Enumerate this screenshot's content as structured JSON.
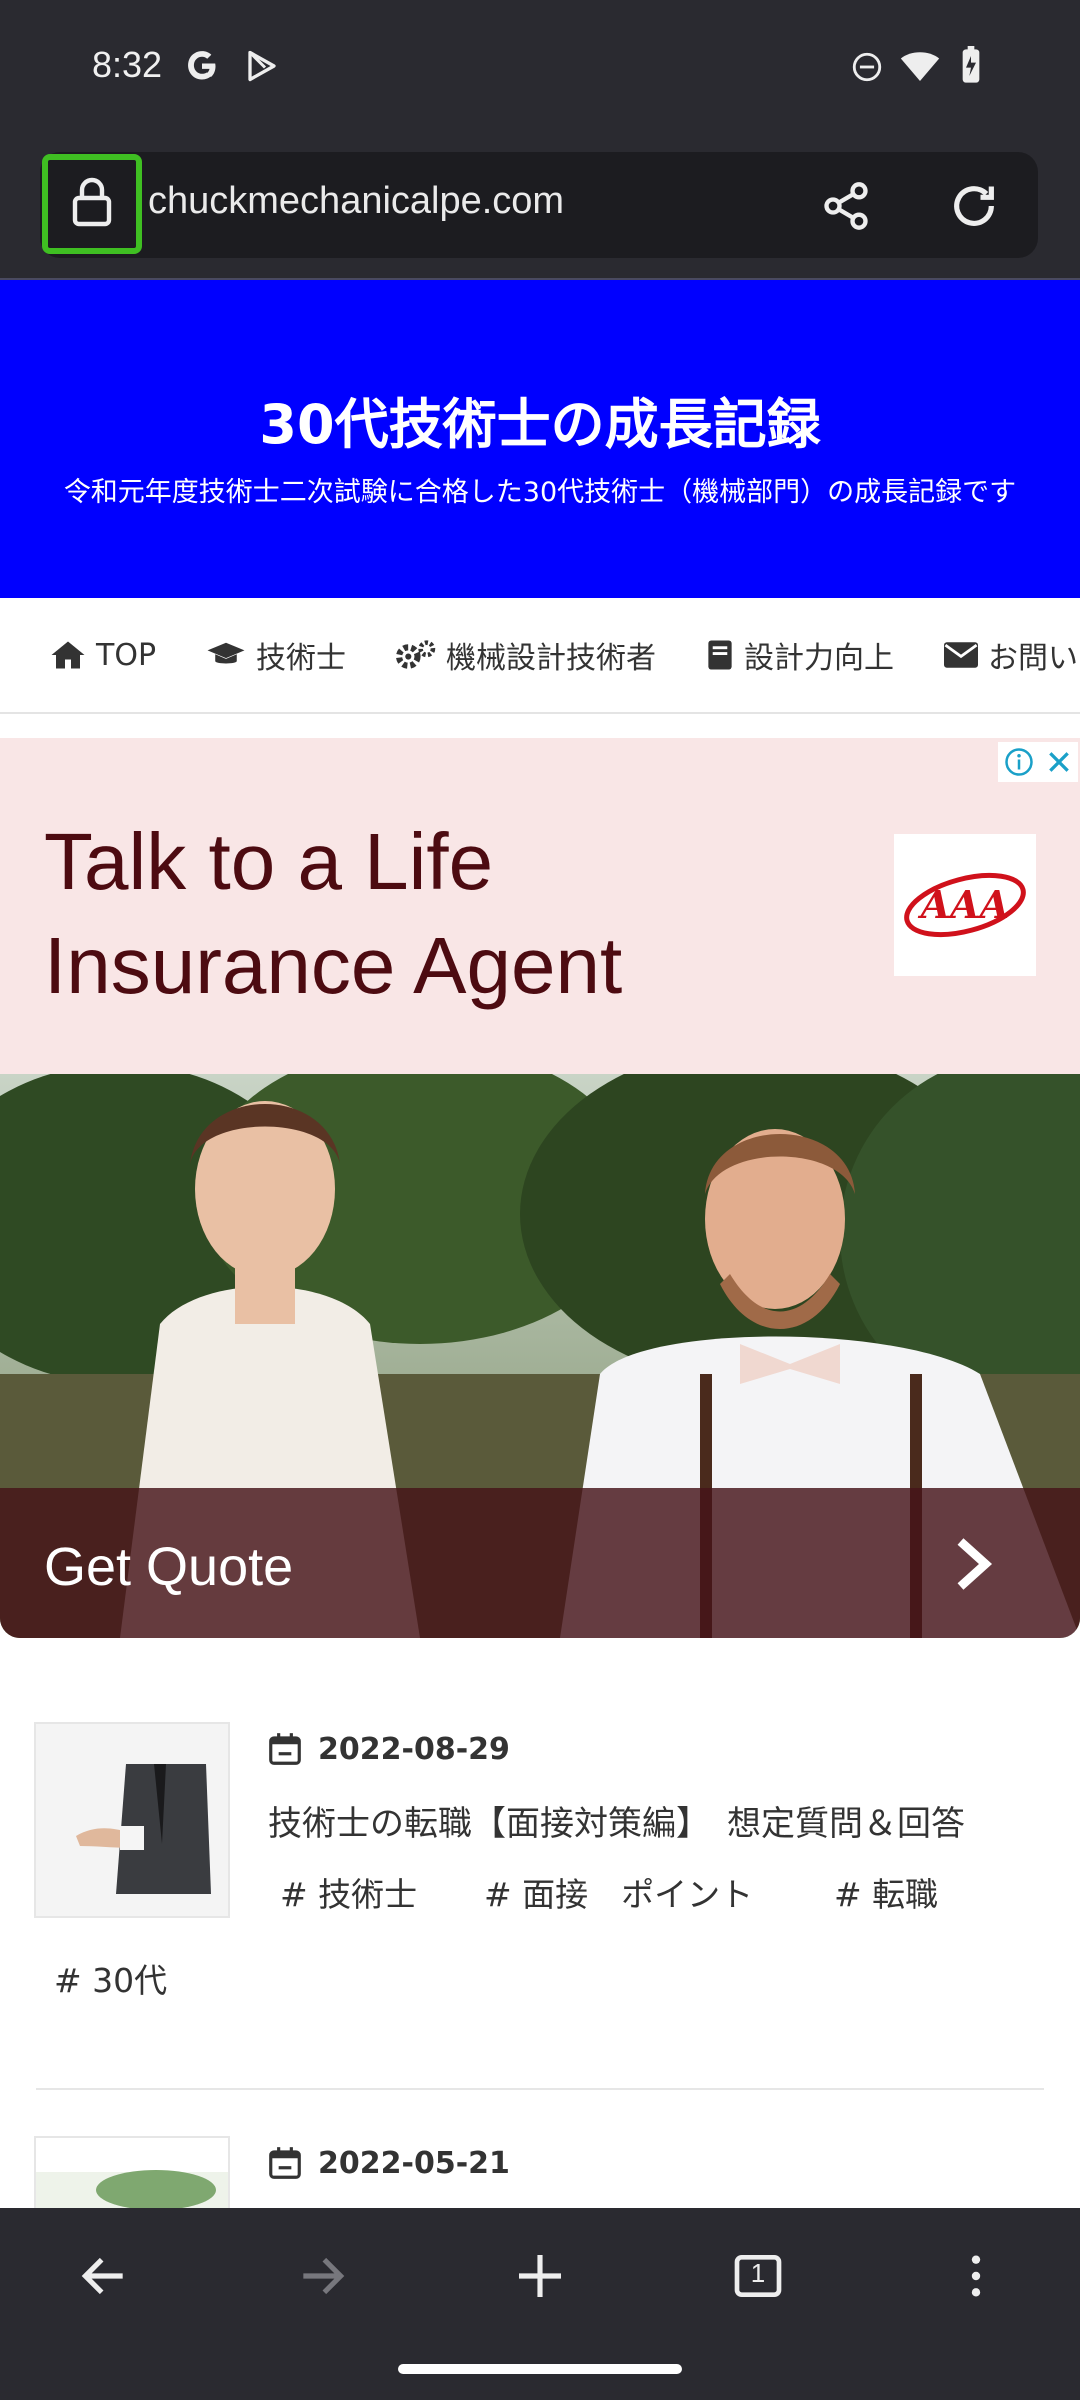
{
  "status_bar": {
    "time": "8:32"
  },
  "browser": {
    "url": "chuckmechanicalpe.com",
    "tab_count": "1"
  },
  "site": {
    "title": "30代技術士の成長記録",
    "subtitle": "令和元年度技術士二次試験に合格した30代技術士（機械部門）の成長記録です"
  },
  "nav": [
    {
      "label": "TOP",
      "icon": "home-icon"
    },
    {
      "label": "技術士",
      "icon": "graduation-cap-icon"
    },
    {
      "label": "機械設計技術者",
      "icon": "gears-icon"
    },
    {
      "label": "設計力向上",
      "icon": "book-icon"
    },
    {
      "label": "お問い",
      "icon": "envelope-icon"
    }
  ],
  "ad": {
    "headline_line1": "Talk to a Life",
    "headline_line2": "Insurance Agent",
    "logo_text": "AAA",
    "cta": "Get Quote"
  },
  "posts": [
    {
      "date": "2022-08-29",
      "title": "技術士の転職【面接対策編】　想定質問＆回答",
      "tags": [
        "# 技術士",
        "# 面接　ポイント",
        "# 転職",
        "# 30代"
      ]
    },
    {
      "date": "2022-05-21"
    }
  ]
}
